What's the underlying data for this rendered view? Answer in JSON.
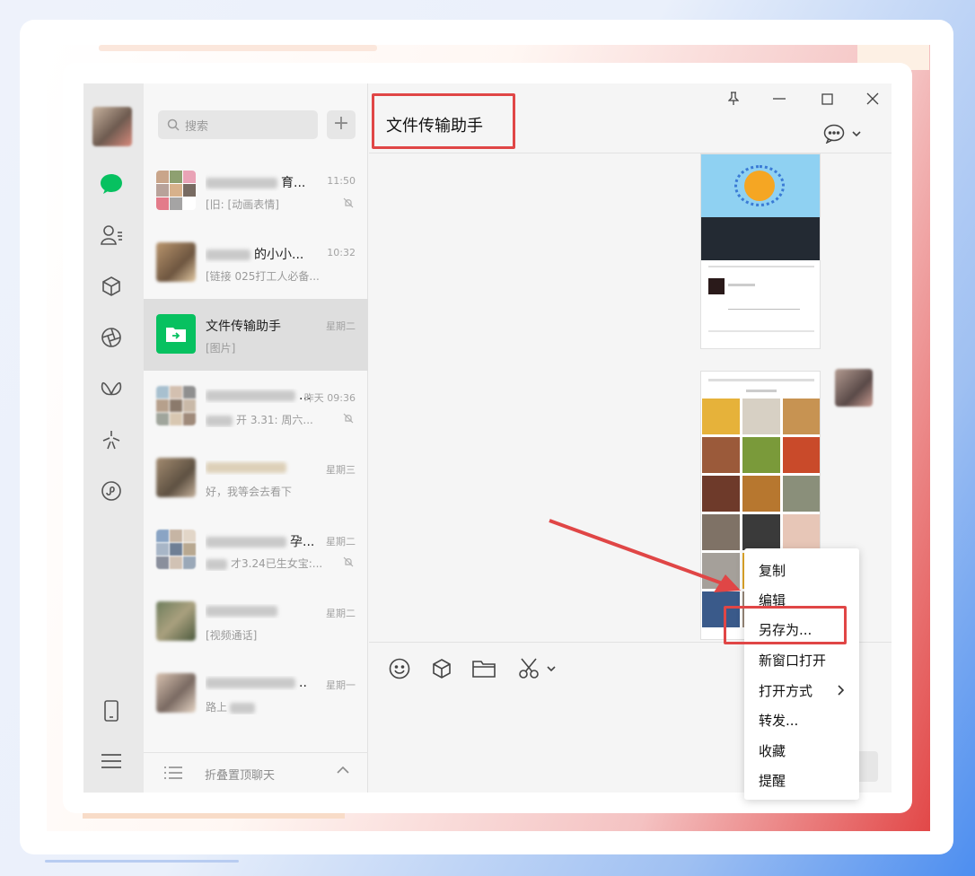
{
  "search": {
    "placeholder": "搜索"
  },
  "chats": [
    {
      "name": "育...",
      "preview": "[旧: [动画表情]",
      "time": "11:50",
      "muted": true
    },
    {
      "name": "的小小...",
      "preview": "[链接 025打工人必备...",
      "time": "10:32",
      "muted": false
    },
    {
      "name": "文件传输助手",
      "preview": "[图片]",
      "time": "星期二",
      "muted": false,
      "active": true
    },
    {
      "name": "...",
      "preview": "开 3.31: 周六...",
      "time": "昨天 09:36",
      "muted": true
    },
    {
      "name": "",
      "preview": "好，我等会去看下",
      "time": "星期三",
      "muted": false
    },
    {
      "name": "孕...",
      "preview": "才3.24已生女宝:...",
      "time": "星期二",
      "muted": true
    },
    {
      "name": "",
      "preview": "[视频通话]",
      "time": "星期二",
      "muted": false
    },
    {
      "name": "..",
      "preview": "路上",
      "time": "星期一",
      "muted": false
    }
  ],
  "fold": {
    "label": "折叠置顶聊天"
  },
  "chat": {
    "title": "文件传输助手"
  },
  "context_menu": {
    "items": [
      "复制",
      "编辑",
      "另存为...",
      "新窗口打开",
      "打开方式",
      "转发...",
      "收藏",
      "提醒"
    ]
  },
  "colors": {
    "highlight": "#e04646",
    "wechat_green": "#07c160",
    "arrow": "#e04646"
  }
}
